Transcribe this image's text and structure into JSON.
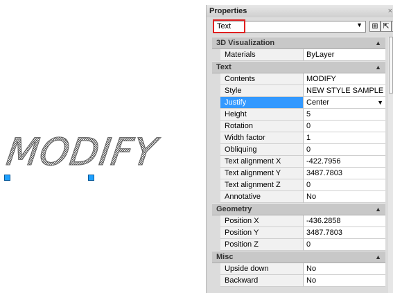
{
  "drawing": {
    "text": "MODIFY"
  },
  "palette": {
    "title": "Properties",
    "close": "×",
    "selector": {
      "value": "Text",
      "arrow": "▼"
    },
    "buttons": [
      {
        "name": "quick-select-icon",
        "glyph": "⊞"
      },
      {
        "name": "select-objects-icon",
        "glyph": "⇱"
      },
      {
        "name": "toggle-pickadd-icon",
        "glyph": "⇲"
      }
    ]
  },
  "categories": [
    {
      "title": "3D Visualization",
      "rows": [
        {
          "name": "Materials",
          "value": "ByLayer"
        }
      ]
    },
    {
      "title": "Text",
      "rows": [
        {
          "name": "Contents",
          "value": "MODIFY"
        },
        {
          "name": "Style",
          "value": "NEW STYLE SAMPLE"
        },
        {
          "name": "Justify",
          "value": "Center",
          "selected": true
        },
        {
          "name": "Height",
          "value": "5"
        },
        {
          "name": "Rotation",
          "value": "0"
        },
        {
          "name": "Width factor",
          "value": "1"
        },
        {
          "name": "Obliquing",
          "value": "0"
        },
        {
          "name": "Text alignment X",
          "value": "-422.7956"
        },
        {
          "name": "Text alignment Y",
          "value": "3487.7803"
        },
        {
          "name": "Text alignment Z",
          "value": "0"
        },
        {
          "name": "Annotative",
          "value": "No"
        }
      ]
    },
    {
      "title": "Geometry",
      "rows": [
        {
          "name": "Position X",
          "value": "-436.2858"
        },
        {
          "name": "Position Y",
          "value": "3487.7803"
        },
        {
          "name": "Position Z",
          "value": "0"
        }
      ]
    },
    {
      "title": "Misc",
      "rows": [
        {
          "name": "Upside down",
          "value": "No"
        },
        {
          "name": "Backward",
          "value": "No"
        }
      ]
    }
  ],
  "colors": {
    "selected_row": "#3399ff",
    "grip": "#1ea0ff",
    "highlight_box": "#e02020"
  },
  "collapse_glyph": "▲",
  "dropdown_glyph": "▼"
}
